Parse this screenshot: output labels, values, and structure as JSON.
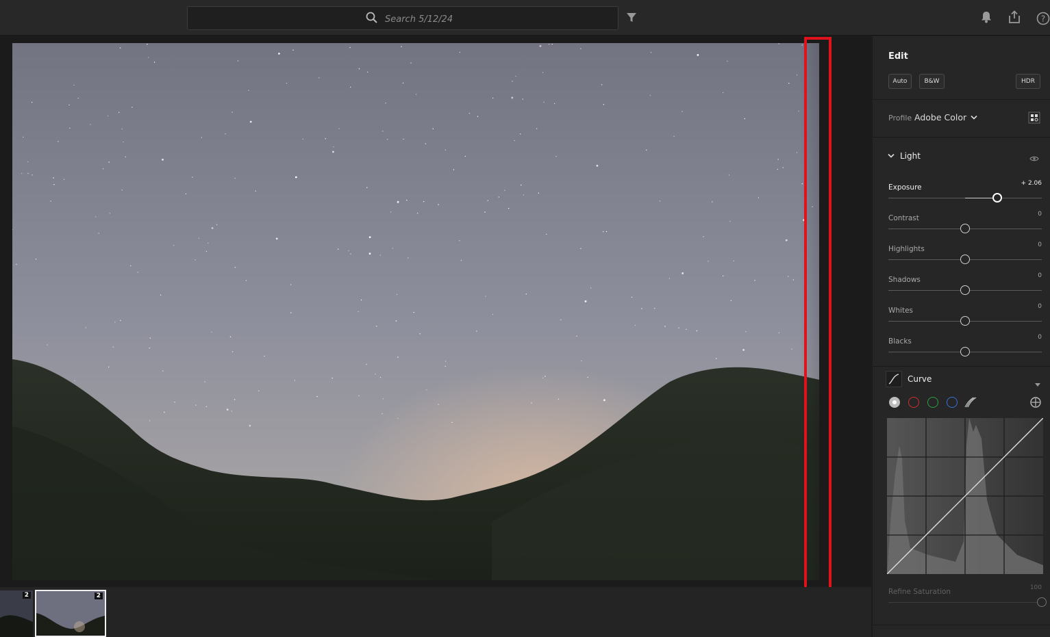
{
  "topbar": {
    "search_placeholder": "Search 5/12/24",
    "icons": [
      "search-icon",
      "filter-icon",
      "bell-icon",
      "share-icon",
      "help-icon"
    ]
  },
  "filmstrip": {
    "thumbs": [
      {
        "badge": "2",
        "selected": false
      },
      {
        "badge": "2",
        "selected": true
      }
    ]
  },
  "panel": {
    "title": "Edit",
    "buttons": {
      "auto": "Auto",
      "bw": "B&W",
      "hdr": "HDR"
    },
    "profile_label": "Profile",
    "profile_value": "Adobe Color",
    "light_section": "Light",
    "sliders": [
      {
        "label": "Exposure",
        "value": "+ 2.06",
        "fraction": 0.71
      },
      {
        "label": "Contrast",
        "value": "0",
        "fraction": 0.5
      },
      {
        "label": "Highlights",
        "value": "0",
        "fraction": 0.5
      },
      {
        "label": "Shadows",
        "value": "0",
        "fraction": 0.5
      },
      {
        "label": "Whites",
        "value": "0",
        "fraction": 0.5
      },
      {
        "label": "Blacks",
        "value": "0",
        "fraction": 0.5
      }
    ],
    "curve_section": "Curve",
    "channel_colors": [
      "#bdbdbd",
      "#d0302c",
      "#2aa33c",
      "#3a6fd8"
    ],
    "refine_saturation": {
      "label": "Refine Saturation",
      "value": "100",
      "fraction": 1.0
    }
  },
  "colors": {
    "highlight": "#e0121b"
  }
}
